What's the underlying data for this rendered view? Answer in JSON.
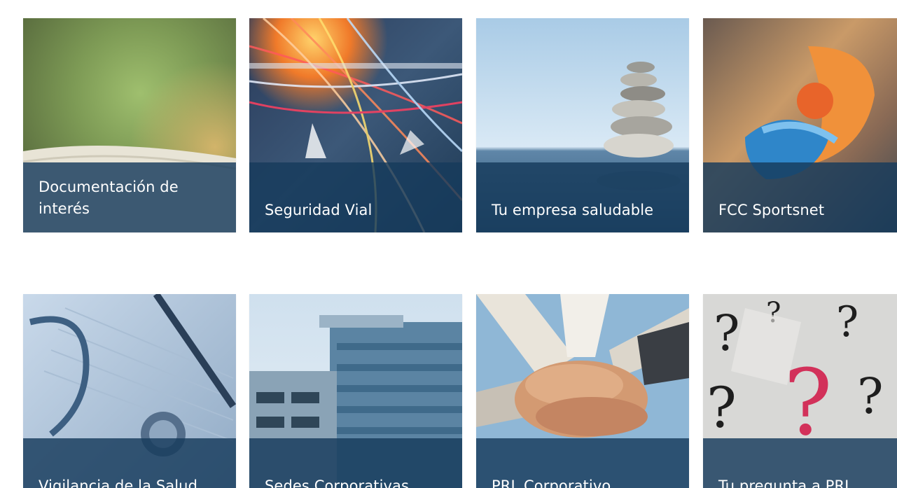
{
  "tiles": [
    {
      "label": "Documentación de interés",
      "line1": "Documentación de",
      "line2": "interés"
    },
    {
      "label": "Seguridad Vial"
    },
    {
      "label": "Tu empresa saludable"
    },
    {
      "label": "FCC Sportsnet"
    },
    {
      "label": "Vigilancia de la Salud"
    },
    {
      "label": "Sedes Corporativas"
    },
    {
      "label": "PRL Corporativo"
    },
    {
      "label": "Tu pregunta a PRL"
    }
  ],
  "colors": {
    "caption_bg": "#163a5c",
    "caption_text": "#ffffff",
    "page_bg": "#ffffff"
  }
}
